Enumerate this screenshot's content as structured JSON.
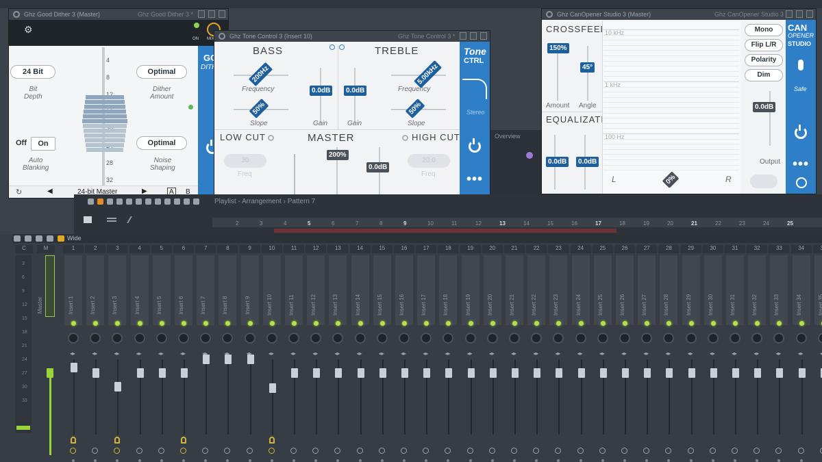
{
  "dither": {
    "title": "Ghz Good Dither 3 (Master)",
    "title2": "Ghz Good Dither 3 *",
    "bit_depth_value": "24 Bit",
    "bit_depth_label": "Bit\nDepth",
    "dither_amount_value": "Optimal",
    "dither_amount_label": "Dither\nAmount",
    "noise_shaping_value": "Optimal",
    "noise_shaping_label": "Noise\nShaping",
    "auto_blanking_off": "Off",
    "auto_blanking_on": "On",
    "auto_blanking_label": "Auto\nBlanking",
    "scale": [
      "4",
      "8",
      "12",
      "16",
      "20",
      "24",
      "28",
      "32"
    ],
    "preset": "24-bit Master",
    "brand_short": "GO",
    "brand_sub": "DITH",
    "mix_label": "MIX",
    "on_label": "ON",
    "nav_a": "A",
    "nav_b": "B"
  },
  "tone": {
    "title": "Ghz Tone Control 3 (Insert 10)",
    "title2": "Ghz Tone Control 3 *",
    "bass": "BASS",
    "treble": "TREBLE",
    "bass_freq": "200Hz",
    "bass_freq_label": "Frequency",
    "bass_slope": "50%",
    "bass_slope_label": "Slope",
    "bass_gain": "0.0dB",
    "bass_gain_label": "Gain",
    "treble_gain": "0.0dB",
    "treble_gain_label": "Gain",
    "treble_freq": "5.00kHz",
    "treble_freq_label": "Frequency",
    "treble_slope": "50%",
    "treble_slope_label": "Slope",
    "low_cut": "LOW CUT",
    "master": "MASTER",
    "high_cut": "HIGH CUT",
    "master_width": "200%",
    "master_gain": "0.0dB",
    "low_cut_value": "30",
    "low_cut_label": "Freq",
    "high_cut_value": "20.0",
    "high_cut_label": "Freq",
    "brand": "Tone",
    "brand_sub": "CTRL",
    "stereo_label": "Stereo"
  },
  "canopener": {
    "title": "Ghz CanOpener Studio 3 (Master)",
    "title2": "Ghz CanOpener Studio 3 *",
    "crossfeed": "CROSSFEED",
    "amount_value": "150%",
    "amount_label": "Amount",
    "angle_value": "45°",
    "angle_label": "Angle",
    "equalization": "EQUALIZATION",
    "eq1": "0.0dB",
    "eq2": "0.0dB",
    "freq_labels": [
      "10 kHz",
      "1 kHz",
      "100 Hz"
    ],
    "left": "L",
    "right": "R",
    "balance": "0%",
    "buttons": [
      "Mono",
      "Flip L/R",
      "Polarity",
      "Dim"
    ],
    "output_value": "0.0dB",
    "output_label": "Output",
    "brand": [
      "CAN",
      "OPENER",
      "STUDIO"
    ],
    "safe_label": "Safe"
  },
  "playlist": {
    "title": "Playlist - Arrangement",
    "pattern": "Pattern 7",
    "overview": "Overview",
    "ruler": [
      "2",
      "3",
      "4",
      "5",
      "6",
      "7",
      "8",
      "9",
      "10",
      "11",
      "12",
      "13",
      "14",
      "15",
      "16",
      "17",
      "18",
      "19",
      "20",
      "21",
      "22",
      "23",
      "24",
      "25"
    ],
    "ruler_hi": [
      "5",
      "9",
      "13",
      "17",
      "21",
      "25"
    ]
  },
  "mixer": {
    "view": "Wide",
    "c_label": "C",
    "m_label": "M",
    "master_name": "Master",
    "scale": [
      "3",
      "6",
      "9",
      "12",
      "15",
      "18",
      "21",
      "24",
      "27",
      "30",
      "33"
    ],
    "strips": [
      {
        "num": "1",
        "name": "Insert 1"
      },
      {
        "num": "2",
        "name": "Insert 2"
      },
      {
        "num": "3",
        "name": "Insert 3"
      },
      {
        "num": "4",
        "name": "Insert 4"
      },
      {
        "num": "5",
        "name": "Insert 5"
      },
      {
        "num": "6",
        "name": "Insert 6"
      },
      {
        "num": "7",
        "name": "Insert 7"
      },
      {
        "num": "8",
        "name": "Insert 8"
      },
      {
        "num": "9",
        "name": "Insert 9"
      },
      {
        "num": "10",
        "name": "Insert 10"
      },
      {
        "num": "11",
        "name": "Insert 11"
      },
      {
        "num": "12",
        "name": "Insert 12"
      },
      {
        "num": "13",
        "name": "Insert 13"
      },
      {
        "num": "14",
        "name": "Insert 14"
      },
      {
        "num": "15",
        "name": "Insert 15"
      },
      {
        "num": "16",
        "name": "Insert 16"
      },
      {
        "num": "17",
        "name": "Insert 17"
      },
      {
        "num": "18",
        "name": "Insert 18"
      },
      {
        "num": "19",
        "name": "Insert 19"
      },
      {
        "num": "20",
        "name": "Insert 20"
      },
      {
        "num": "21",
        "name": "Insert 21"
      },
      {
        "num": "22",
        "name": "Insert 22"
      },
      {
        "num": "23",
        "name": "Insert 23"
      },
      {
        "num": "24",
        "name": "Insert 24"
      },
      {
        "num": "25",
        "name": "Insert 25"
      },
      {
        "num": "26",
        "name": "Insert 26"
      },
      {
        "num": "27",
        "name": "Insert 27"
      },
      {
        "num": "28",
        "name": "Insert 28"
      },
      {
        "num": "29",
        "name": "Insert 29"
      },
      {
        "num": "30",
        "name": "Insert 30"
      },
      {
        "num": "31",
        "name": "Insert 31"
      },
      {
        "num": "32",
        "name": "Insert 32"
      },
      {
        "num": "33",
        "name": "Insert 33"
      },
      {
        "num": "34",
        "name": "Insert 34"
      },
      {
        "num": "35",
        "name": "Insert 35"
      }
    ]
  }
}
